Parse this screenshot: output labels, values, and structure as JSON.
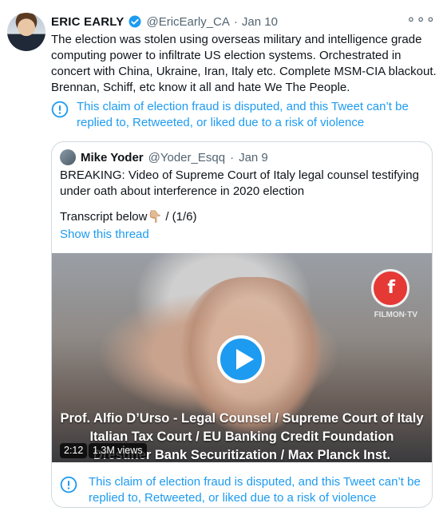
{
  "author": {
    "name": "ERIC EARLY",
    "handle": "@EricEarly_CA",
    "date": "Jan 10"
  },
  "tweet": {
    "text": "The election was stolen using overseas military and intelligence grade computing power to infiltrate US election systems. Orchestrated in concert with China, Ukraine, Iran, Italy etc. Complete MSM-CIA blackout. Brennan, Schiff, etc know it all and hate We The People."
  },
  "notice": {
    "text": "This claim of election fraud is disputed, and this Tweet can’t be replied to, Retweeted, or liked due to a risk of violence"
  },
  "quoted": {
    "name": "Mike Yoder",
    "handle": "@Yoder_Esqq",
    "date": "Jan 9",
    "text": "BREAKING: Video of Supreme Court of Italy legal counsel testifying under oath about interference in 2020 election",
    "transcript": "Transcript below👇🏼 / (1/6)",
    "show_thread": "Show this thread"
  },
  "video": {
    "logo_glyph": "f",
    "logo_text": "FILMON·TV",
    "caption_line1": "Prof. Alfio D’Urso - Legal Counsel / Supreme Court of Italy",
    "caption_line2": "Italian Tax Court / EU Banking Credit Foundation",
    "caption_line3": "Dresdner Bank Securitization / Max Planck Inst.",
    "duration": "2:12",
    "views": "1.3M views"
  },
  "icons": {
    "verified": "verified-badge-icon",
    "more": "more-horizontal-icon",
    "notice": "exclamation-circle-icon",
    "play": "play-icon"
  },
  "colors": {
    "accent": "#1d9bf0",
    "text": "#0f1419",
    "muted": "#536471",
    "border": "#cfd9de"
  },
  "more_glyph": "∘∘∘",
  "separator": "·"
}
